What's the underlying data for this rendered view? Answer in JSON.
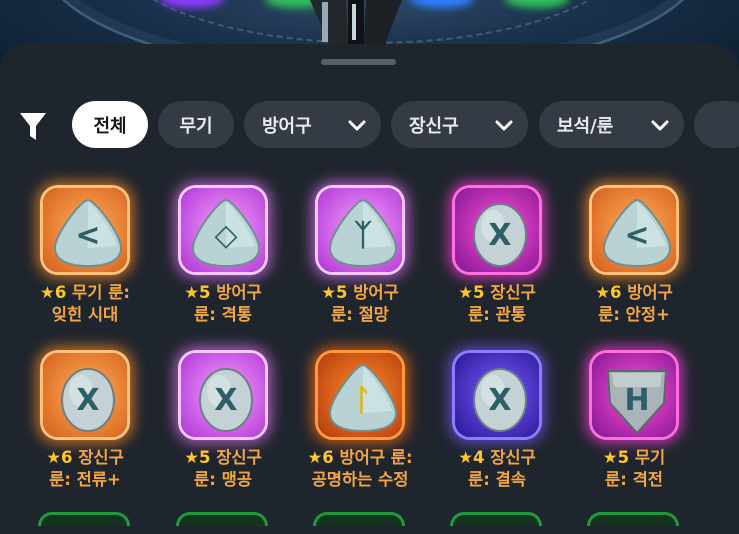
{
  "filter_bar": {
    "chips": [
      {
        "label": "전체",
        "active": true
      },
      {
        "label": "무기",
        "active": false
      },
      {
        "label": "방어구",
        "active": false,
        "dropdown": true
      },
      {
        "label": "장신구",
        "active": false,
        "dropdown": true
      },
      {
        "label": "보석/룬",
        "active": false,
        "dropdown": true
      }
    ]
  },
  "items": [
    {
      "stars": "★6",
      "line1": " 무기 룬:",
      "line2": "잊힌 시대",
      "rarity": "orange",
      "glyph": "<",
      "stone": "tri"
    },
    {
      "stars": "★5",
      "line1": " 방어구",
      "line2": "룬: 격통",
      "rarity": "pink",
      "glyph": "◇",
      "stone": "tri"
    },
    {
      "stars": "★5",
      "line1": " 방어구",
      "line2": "룬: 절망",
      "rarity": "pink",
      "glyph": "ᛉ",
      "stone": "tri"
    },
    {
      "stars": "★5",
      "line1": " 장신구",
      "line2": "룬: 관통",
      "rarity": "magenta",
      "glyph": "X",
      "stone": "oval"
    },
    {
      "stars": "★6",
      "line1": " 방어구",
      "line2": "룬: 안정+",
      "rarity": "orange",
      "glyph": "<",
      "stone": "tri"
    },
    {
      "stars": "★6",
      "line1": " 장신구",
      "line2": "룬: 전류+",
      "rarity": "orange",
      "glyph": "X",
      "stone": "oval"
    },
    {
      "stars": "★5",
      "line1": " 장신구",
      "line2": "룬: 맹공",
      "rarity": "pink",
      "glyph": "X",
      "stone": "oval"
    },
    {
      "stars": "★6",
      "line1": " 방어구 룬:",
      "line2": "공명하는 수정",
      "rarity": "orange-gold",
      "glyph": "ᛚ",
      "stone": "tri"
    },
    {
      "stars": "★4",
      "line1": " 장신구",
      "line2": "룬: 결속",
      "rarity": "purple",
      "glyph": "X",
      "stone": "oval"
    },
    {
      "stars": "★5",
      "line1": " 무기",
      "line2": "룬: 격전",
      "rarity": "magenta",
      "glyph": "H",
      "stone": "shield"
    }
  ],
  "colors": {
    "sheet_bg": "#1f252d",
    "chip_bg": "#353b44",
    "chip_active_bg": "#ffffff",
    "name_text": "#f3a742",
    "star": "#ffc629"
  }
}
